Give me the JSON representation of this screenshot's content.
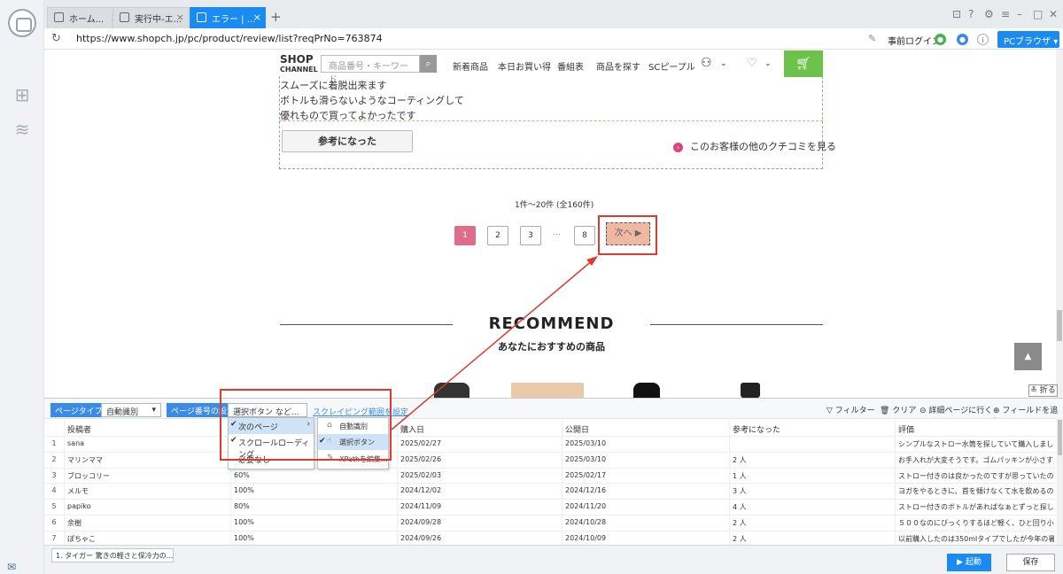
{
  "tabs": [
    {
      "label": "ホーム..."
    },
    {
      "label": "実行中-エ..."
    },
    {
      "label": "エラー | ..."
    }
  ],
  "address": {
    "url": "https://www.shopch.jp/pc/product/review/list?reqPrNo=763874",
    "login": "事前ログイン",
    "pc_browser": "PCブラウザ"
  },
  "shop": {
    "logo_top": "SHOP",
    "logo_bottom": "CHANNEL",
    "search_placeholder": "商品番号・キーワード",
    "nav": [
      "新着商品",
      "本日お買い得",
      "番組表",
      "商品を探す",
      "SCピープル"
    ],
    "review_lines": [
      "スムーズに着脱出来ます",
      "ボトルも滑らないようなコーティングして",
      "優れもので買ってよかったです"
    ],
    "helpful_button": "参考になった",
    "other_reviews_link": "このお客様の他のクチコミを見る",
    "result_count": "1件～20件 (全160件)",
    "pages": [
      "1",
      "2",
      "3",
      "8"
    ],
    "page_ellipsis": "…",
    "next_button": "次へ",
    "recommend_title": "RECOMMEND",
    "recommend_subtitle": "あなたにおすすめの商品"
  },
  "panel": {
    "fold": "折る",
    "page_type_label": "ページタイプ",
    "page_type_value": "自動識別",
    "page_setting_label": "ページ番号の設定",
    "page_setting_value": "選択ボタン など...",
    "scrape_range": "スクレイピング範囲を設定",
    "tools": [
      "フィルター",
      "クリア",
      "詳細ページに行く",
      "フィールドを追加"
    ],
    "columns": [
      "投稿者",
      "",
      "購入日",
      "公開日",
      "参考になった",
      "評価"
    ],
    "rows": [
      {
        "n": "1",
        "poster": "sana",
        "rate": "",
        "purchase": "2025/02/27",
        "publish": "2025/03/10",
        "helpful": "",
        "review": "シンプルなストロー水筒を探していて購入しました..."
      },
      {
        "n": "2",
        "poster": "マリンママ",
        "rate": "",
        "purchase": "2025/02/26",
        "publish": "2025/03/10",
        "helpful": "2 人",
        "review": "お手入れが大変そうです。ゴムパッキンが小さすぎ..."
      },
      {
        "n": "3",
        "poster": "ブロッコリー",
        "rate": "60%",
        "purchase": "2025/02/03",
        "publish": "2025/02/17",
        "helpful": "1 人",
        "review": "ストロー付きのは良かったのですが思っていたのと..."
      },
      {
        "n": "4",
        "poster": "メルモ",
        "rate": "100%",
        "purchase": "2024/12/02",
        "publish": "2024/12/16",
        "helpful": "3 人",
        "review": "ヨガをやるときに、首を傾けなくて水を飲めるのは..."
      },
      {
        "n": "5",
        "poster": "papiko",
        "rate": "80%",
        "purchase": "2024/11/09",
        "publish": "2024/11/20",
        "helpful": "4 人",
        "review": "ストロー付きのボトルがあればなぁとずっと探して..."
      },
      {
        "n": "6",
        "poster": "余樹",
        "rate": "100%",
        "purchase": "2024/09/28",
        "publish": "2024/10/28",
        "helpful": "2 人",
        "review": "５００なのにびっくりするほど軽く、ひと回り小さ..."
      },
      {
        "n": "7",
        "poster": "ぽちゃこ",
        "rate": "100%",
        "purchase": "2024/09/26",
        "publish": "2024/10/09",
        "helpful": "2 人",
        "review": "以前購入したのは350mlタイプでしたが今年の暑さ..."
      }
    ],
    "dropdown": [
      "次のページ",
      "スクロールローディング",
      "必要なし"
    ],
    "submenu": [
      "自動識別",
      "選択ボタン",
      "XPathを編集..."
    ]
  },
  "bottom": {
    "breadcrumb": "1. タイガー 驚きの軽さと保冷力の...",
    "run": "起動",
    "save": "保存"
  },
  "colors": {
    "accent": "#1a8bf0",
    "highlight": "#e03a2f",
    "cart": "#6cc24a",
    "active_page": "#e06c8a"
  }
}
